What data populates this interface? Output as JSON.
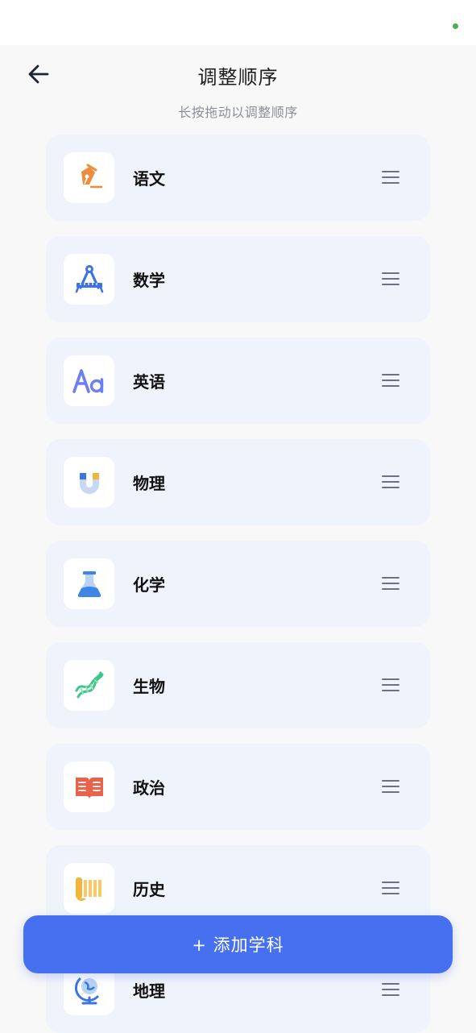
{
  "header": {
    "title": "调整顺序",
    "back_icon": "arrow-left-icon"
  },
  "hint": "长按拖动以调整顺序",
  "subjects": [
    {
      "name": "语文",
      "icon": "fountain-pen-icon",
      "color": "#f08a3c"
    },
    {
      "name": "数学",
      "icon": "compass-ruler-icon",
      "color": "#3b73e6"
    },
    {
      "name": "英语",
      "icon": "aa-letters-icon",
      "color": "#6b7ef2"
    },
    {
      "name": "物理",
      "icon": "magnet-icon",
      "color": "#3b73e6"
    },
    {
      "name": "化学",
      "icon": "flask-icon",
      "color": "#3d86e6"
    },
    {
      "name": "生物",
      "icon": "dna-icon",
      "color": "#3cc78a"
    },
    {
      "name": "政治",
      "icon": "open-book-icon",
      "color": "#e8634a"
    },
    {
      "name": "历史",
      "icon": "scroll-icon",
      "color": "#f2b43a"
    },
    {
      "name": "地理",
      "icon": "globe-icon",
      "color": "#3b73e6"
    }
  ],
  "add_button": {
    "label": "+ 添加学科"
  },
  "colors": {
    "accent": "#4670f0",
    "card_bg": "#eff3fb",
    "status_dot": "#4caf50"
  }
}
